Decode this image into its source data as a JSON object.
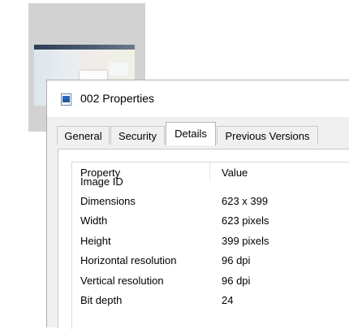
{
  "window": {
    "title": "002 Properties"
  },
  "tabs": [
    "General",
    "Security",
    "Details",
    "Previous Versions"
  ],
  "active_tab": "Details",
  "details": {
    "columns": {
      "property": "Property",
      "value": "Value"
    },
    "rows": [
      {
        "property": "Image ID",
        "value": ""
      },
      {
        "property": "Dimensions",
        "value": "623 x 399"
      },
      {
        "property": "Width",
        "value": "623 pixels"
      },
      {
        "property": "Height",
        "value": "399 pixels"
      },
      {
        "property": "Horizontal resolution",
        "value": "96 dpi"
      },
      {
        "property": "Vertical resolution",
        "value": "96 dpi"
      },
      {
        "property": "Bit depth",
        "value": "24"
      }
    ]
  }
}
